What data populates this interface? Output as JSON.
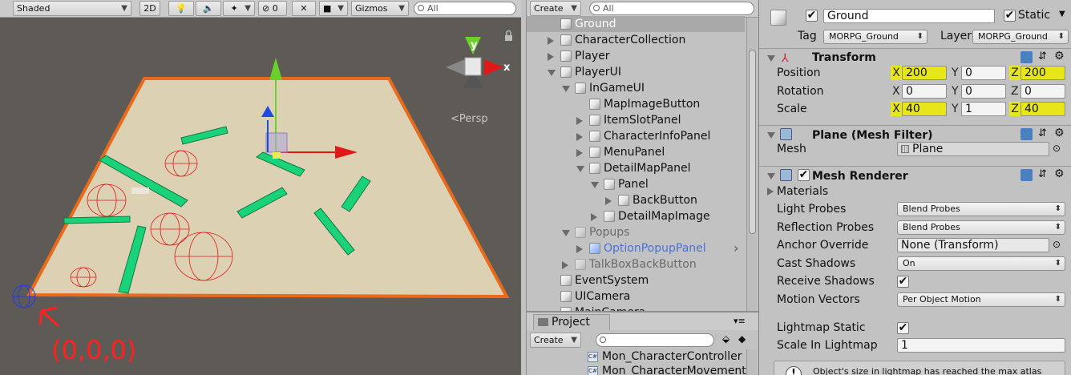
{
  "scene_toolbar": {
    "shading_mode": "Shaded",
    "mode_2d": "2D",
    "effects_count": "0",
    "gizmos": "Gizmos",
    "search_placeholder": "All"
  },
  "scene": {
    "persp_label": "<Persp",
    "gizmo_y": "y",
    "gizmo_x": "x",
    "annotation": "(0,0,0)"
  },
  "hierarchy": {
    "create_label": "Create",
    "search_placeholder": "All",
    "items": [
      {
        "label": "Ground",
        "depth": 0,
        "arrow": "none",
        "selected": true
      },
      {
        "label": "CharacterCollection",
        "depth": 0,
        "arrow": "right"
      },
      {
        "label": "Player",
        "depth": 0,
        "arrow": "right"
      },
      {
        "label": "PlayerUI",
        "depth": 0,
        "arrow": "down"
      },
      {
        "label": "InGameUI",
        "depth": 1,
        "arrow": "down"
      },
      {
        "label": "MapImageButton",
        "depth": 2,
        "arrow": "none"
      },
      {
        "label": "ItemSlotPanel",
        "depth": 2,
        "arrow": "right"
      },
      {
        "label": "CharacterInfoPanel",
        "depth": 2,
        "arrow": "right"
      },
      {
        "label": "MenuPanel",
        "depth": 2,
        "arrow": "right"
      },
      {
        "label": "DetailMapPanel",
        "depth": 2,
        "arrow": "down"
      },
      {
        "label": "Panel",
        "depth": 3,
        "arrow": "down"
      },
      {
        "label": "BackButton",
        "depth": 4,
        "arrow": "right"
      },
      {
        "label": "DetailMapImage",
        "depth": 3,
        "arrow": "right"
      },
      {
        "label": "Popups",
        "depth": 1,
        "arrow": "down",
        "inactive": true
      },
      {
        "label": "OptionPopupPanel",
        "depth": 2,
        "arrow": "right",
        "prefab": true
      },
      {
        "label": "TalkBoxBackButton",
        "depth": 1,
        "arrow": "right",
        "inactive": true
      },
      {
        "label": "EventSystem",
        "depth": 0,
        "arrow": "none"
      },
      {
        "label": "UICamera",
        "depth": 0,
        "arrow": "none"
      },
      {
        "label": "MainCamera",
        "depth": 0,
        "arrow": "none"
      }
    ]
  },
  "project": {
    "tab_label": "Project",
    "create_label": "Create",
    "files": [
      "Mon_CharacterController",
      "Mon_CharacterMovement"
    ]
  },
  "inspector": {
    "object_name": "Ground",
    "static_label": "Static",
    "tag_label": "Tag",
    "tag_value": "MORPG_Ground",
    "layer_label": "Layer",
    "layer_value": "MORPG_Ground",
    "transform": {
      "title": "Transform",
      "position": {
        "label": "Position",
        "x": "200",
        "y": "0",
        "z": "200"
      },
      "rotation": {
        "label": "Rotation",
        "x": "0",
        "y": "0",
        "z": "0"
      },
      "scale": {
        "label": "Scale",
        "x": "40",
        "y": "1",
        "z": "40"
      }
    },
    "axis_x": "X",
    "axis_y": "Y",
    "axis_z": "Z",
    "mesh_filter": {
      "title": "Plane (Mesh Filter)",
      "mesh_label": "Mesh",
      "mesh_value": "Plane"
    },
    "mesh_renderer": {
      "title": "Mesh Renderer",
      "materials": "Materials",
      "light_probes_label": "Light Probes",
      "light_probes": "Blend Probes",
      "reflection_probes_label": "Reflection Probes",
      "reflection_probes": "Blend Probes",
      "anchor_override_label": "Anchor Override",
      "anchor_override": "None (Transform)",
      "cast_shadows_label": "Cast Shadows",
      "cast_shadows": "On",
      "receive_shadows_label": "Receive Shadows",
      "motion_vectors_label": "Motion Vectors",
      "motion_vectors": "Per Object Motion",
      "lightmap_static_label": "Lightmap Static",
      "scale_in_lightmap_label": "Scale In Lightmap",
      "scale_in_lightmap": "1",
      "warning": "Object's size in lightmap has reached the max atlas"
    }
  },
  "colors": {
    "highlight": "#e6e61a",
    "ground": "#ddd1b4",
    "ground_border": "#ea6a1c",
    "obstacle": "#19d27a",
    "selection": "#cfcfcf"
  }
}
